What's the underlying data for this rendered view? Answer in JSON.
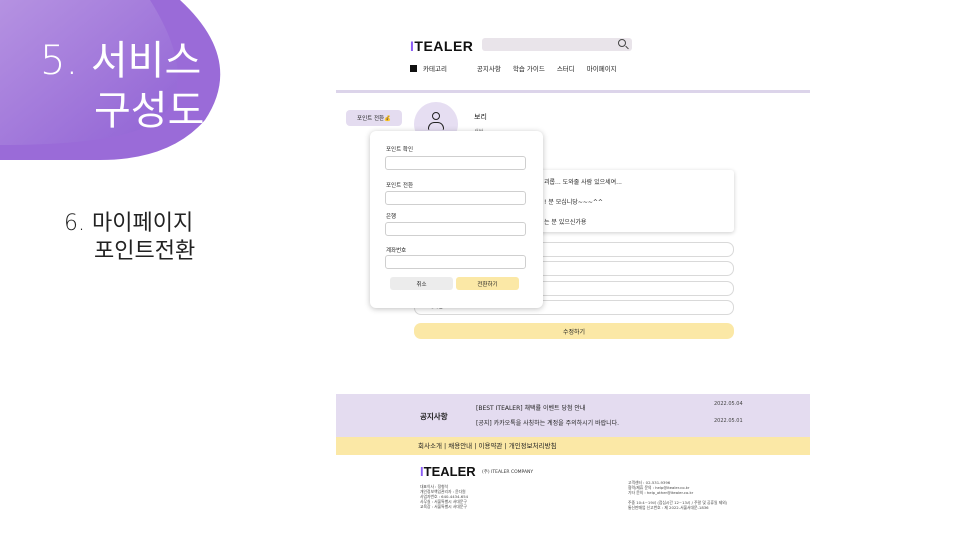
{
  "slide": {
    "title_line1": "5. 서비스",
    "title_line2": "구성도",
    "subtitle_line1": "6. 마이페이지",
    "subtitle_line2": "포인트전환",
    "colors": {
      "blob_start": "#b99ae3",
      "blob_end": "#8f63d4",
      "accent": "#8b5cf6",
      "lavender": "#e4dcf0",
      "yellow": "#fbe8a6"
    }
  },
  "header": {
    "logo_mark": "I",
    "logo_text": "TEALER",
    "search_icon": "search-icon",
    "category": "카테고리",
    "nav": [
      "공지사항",
      "학습 가이드",
      "스터디",
      "마이페이지"
    ]
  },
  "profile": {
    "point_button": "포인트 전환💰",
    "name": "보리",
    "grade": "새싹",
    "avatar_icon": "user-icon"
  },
  "bubble": {
    "line1": "괴롭... 도와줄 사람 있으세여...",
    "line2": "! 분 모십니당~~~^^",
    "line3": "는 분 있으신가용"
  },
  "fields": {
    "account": "계좌번호",
    "submit": "수정하기"
  },
  "modal": {
    "labels": [
      "포인트 확인",
      "포인트 전환",
      "은행",
      "계좌번호"
    ],
    "cancel": "취소",
    "convert": "전환하기"
  },
  "notice": {
    "title": "공지사항",
    "rows": [
      {
        "text": "[BEST ITEALER] 채택률 이벤트 당첨 안내",
        "date": "2022.05.04"
      },
      {
        "text": "[공지] 카카오톡을 사칭하는 계정을 주의하시기 바랍니다.",
        "date": "2022.05.01"
      }
    ]
  },
  "footer": {
    "links": "회사소개 | 채용안내 | 이용약관 | 개인정보처리방침",
    "logo_mark": "I",
    "logo_text": "TEALER",
    "company": "(주) ITEALER COMPANY",
    "info": [
      "대표이사 : 정형석",
      "개인정보책임관리자 : 윤다원",
      "사업자번호 : 640-4434-654",
      "사무실 : 서울특별시 서대문구",
      "교육장 : 서울특별시 서대문구"
    ],
    "contact": [
      "고객센터 : 02-531-9396",
      "협력/제휴 문의 : help@itealer.co.kr",
      "기타 문의 : help_other@itealer.co.kr",
      "",
      "주중 10:4~19시 (점심시간 12~13시 / 주말 및 공휴일 제외)",
      "통신판매업 신고번호 : 제 2022-서울서대문-1836"
    ]
  }
}
